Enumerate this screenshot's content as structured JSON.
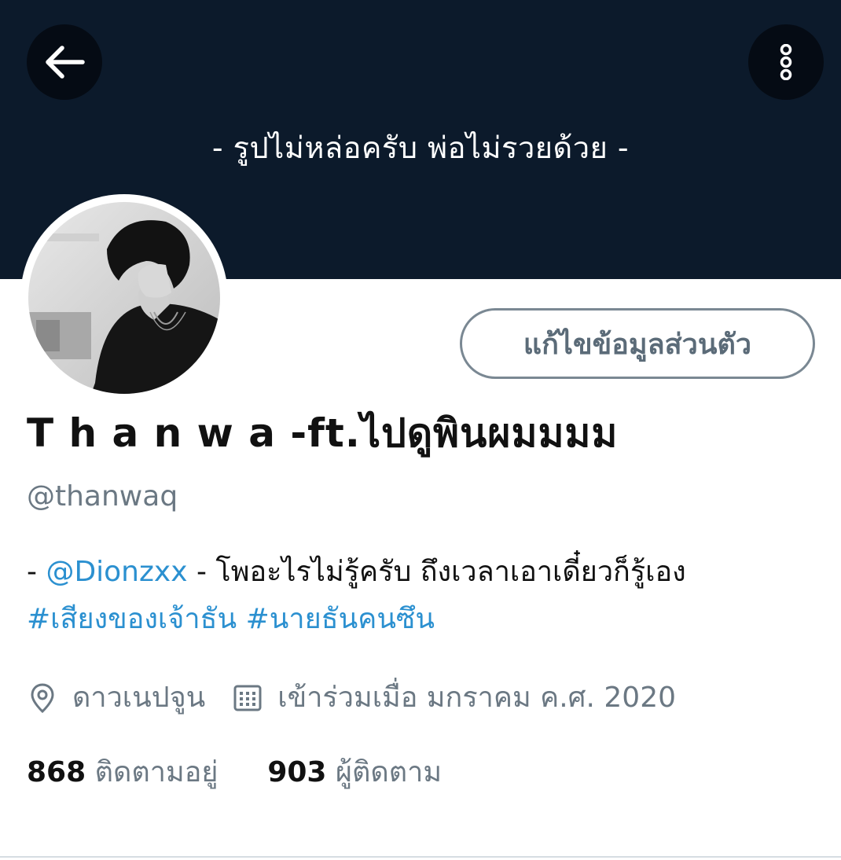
{
  "header": {
    "banner_text": "- รูปไม่หล่อครับ พ่อไม่รวยด้วย -",
    "back_icon": "arrow-left-icon",
    "more_icon": "more-vertical-icon"
  },
  "profile": {
    "edit_button_label": "แก้ไขข้อมูลส่วนตัว",
    "display_name": "T h a n w a -ft.ไปดูพินผมมมม",
    "handle": "@thanwaq",
    "bio": {
      "prefix": "- ",
      "mention": "@Dionzxx",
      "after_mention": " -  โพอะไรไม่รู้ครับ ถึงเวลาเอาเดี๋ยวก็รู้เอง",
      "hashtag1": "#เสียงของเจ้าธัน",
      "hashtag2": "#นายธันคนซึน"
    },
    "location": "ดาวเนปจูน",
    "joined": "เข้าร่วมเมื่อ มกราคม ค.ศ. 2020",
    "following_count": "868",
    "following_label": "ติดตามอยู่",
    "followers_count": "903",
    "followers_label": "ผู้ติดตาม"
  },
  "colors": {
    "banner": "#0c1a2b",
    "link": "#2b90d0",
    "secondary_text": "#6b7883"
  }
}
